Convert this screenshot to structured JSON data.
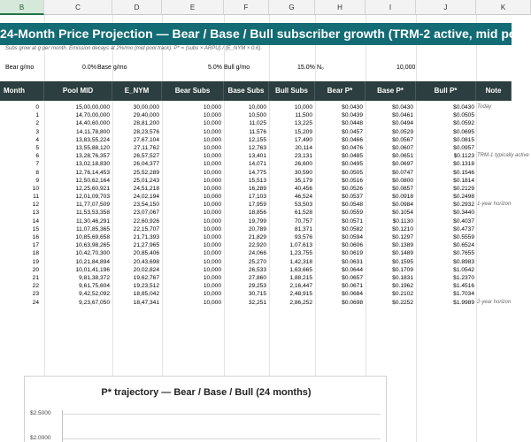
{
  "columns": [
    {
      "label": "B",
      "selected": true
    },
    {
      "label": "C"
    },
    {
      "label": "D"
    },
    {
      "label": "E"
    },
    {
      "label": "F"
    },
    {
      "label": "G"
    },
    {
      "label": "H"
    },
    {
      "label": "I"
    },
    {
      "label": "J"
    },
    {
      "label": "K"
    }
  ],
  "title": "24-Month Price Projection — Bear / Base / Bull subscriber growth (TRM-2 active, mid pool)",
  "subtitle": "Subs grow at g per month. Emission decays at 2%/mo (mid pool track). P* = (subs × ARPU) / (E_NYM × 0.6).",
  "params": {
    "bear_label": "Bear g/mo",
    "bear_value": "0.0%",
    "base_label": "Base g/mo",
    "base_value": "5.0%",
    "bull_label": "Bull g/mo",
    "bull_value": "15.0%",
    "n0_label": "N₀",
    "n0_value": "10,000"
  },
  "headers": [
    "Month",
    "Pool MID",
    "E_NYM",
    "Bear Subs",
    "Base Subs",
    "Bull Subs",
    "Bear P*",
    "Base P*",
    "Bull P*",
    "Note"
  ],
  "rows": [
    [
      "0",
      "15,00,00,000",
      "30,00,000",
      "10,000",
      "10,000",
      "10,000",
      "$0.0430",
      "$0.0430",
      "$0.0430",
      "Today"
    ],
    [
      "1",
      "14,70,00,000",
      "29,40,000",
      "10,000",
      "10,500",
      "11,500",
      "$0.0439",
      "$0.0461",
      "$0.0505",
      ""
    ],
    [
      "2",
      "14,40,60,000",
      "28,81,200",
      "10,000",
      "11,025",
      "13,225",
      "$0.0448",
      "$0.0494",
      "$0.0592",
      ""
    ],
    [
      "3",
      "14,11,78,800",
      "28,23,576",
      "10,000",
      "11,576",
      "15,209",
      "$0.0457",
      "$0.0529",
      "$0.0695",
      ""
    ],
    [
      "4",
      "13,83,55,224",
      "27,67,104",
      "10,000",
      "12,155",
      "17,490",
      "$0.0466",
      "$0.0567",
      "$0.0815",
      ""
    ],
    [
      "5",
      "13,55,88,120",
      "27,11,762",
      "10,000",
      "12,763",
      "20,114",
      "$0.0476",
      "$0.0607",
      "$0.0957",
      ""
    ],
    [
      "6",
      "13,28,76,357",
      "26,57,527",
      "10,000",
      "13,401",
      "23,131",
      "$0.0485",
      "$0.0651",
      "$0.1123",
      "TRM-1 typically active"
    ],
    [
      "7",
      "13,02,18,830",
      "26,04,377",
      "10,000",
      "14,071",
      "26,600",
      "$0.0495",
      "$0.0697",
      "$0.1318",
      ""
    ],
    [
      "8",
      "12,76,14,453",
      "25,52,289",
      "10,000",
      "14,775",
      "30,590",
      "$0.0505",
      "$0.0747",
      "$0.1546",
      ""
    ],
    [
      "9",
      "12,50,62,164",
      "25,01,243",
      "10,000",
      "15,513",
      "35,179",
      "$0.0516",
      "$0.0800",
      "$0.1814",
      ""
    ],
    [
      "10",
      "12,25,60,921",
      "24,51,218",
      "10,000",
      "16,289",
      "40,456",
      "$0.0526",
      "$0.0857",
      "$0.2129",
      ""
    ],
    [
      "11",
      "12,01,09,703",
      "24,02,194",
      "10,000",
      "17,103",
      "46,524",
      "$0.0537",
      "$0.0918",
      "$0.2498",
      ""
    ],
    [
      "12",
      "11,77,07,509",
      "23,54,150",
      "10,000",
      "17,959",
      "53,503",
      "$0.0548",
      "$0.0984",
      "$0.2932",
      "1-year horizon"
    ],
    [
      "13",
      "11,53,53,358",
      "23,07,067",
      "10,000",
      "18,856",
      "61,528",
      "$0.0559",
      "$0.1054",
      "$0.3440",
      ""
    ],
    [
      "14",
      "11,30,46,291",
      "22,60,926",
      "10,000",
      "19,799",
      "70,757",
      "$0.0571",
      "$0.1130",
      "$0.4037",
      ""
    ],
    [
      "15",
      "11,07,85,365",
      "22,15,707",
      "10,000",
      "20,789",
      "81,371",
      "$0.0582",
      "$0.1210",
      "$0.4737",
      ""
    ],
    [
      "16",
      "10,85,69,658",
      "21,71,393",
      "10,000",
      "21,829",
      "93,576",
      "$0.0594",
      "$0.1297",
      "$0.5559",
      ""
    ],
    [
      "17",
      "10,63,98,265",
      "21,27,965",
      "10,000",
      "22,920",
      "1,07,613",
      "$0.0606",
      "$0.1389",
      "$0.6524",
      ""
    ],
    [
      "18",
      "10,42,70,300",
      "20,85,406",
      "10,000",
      "24,066",
      "1,23,755",
      "$0.0619",
      "$0.1489",
      "$0.7655",
      ""
    ],
    [
      "19",
      "10,21,84,894",
      "20,43,698",
      "10,000",
      "25,270",
      "1,42,318",
      "$0.0631",
      "$0.1595",
      "$0.8983",
      ""
    ],
    [
      "20",
      "10,01,41,196",
      "20,02,824",
      "10,000",
      "26,533",
      "1,63,665",
      "$0.0644",
      "$0.1709",
      "$1.0542",
      ""
    ],
    [
      "21",
      "9,81,38,372",
      "19,62,767",
      "10,000",
      "27,860",
      "1,88,215",
      "$0.0657",
      "$0.1831",
      "$1.2370",
      ""
    ],
    [
      "22",
      "9,61,75,604",
      "19,23,512",
      "10,000",
      "29,253",
      "2,16,447",
      "$0.0671",
      "$0.1962",
      "$1.4516",
      ""
    ],
    [
      "23",
      "9,42,52,092",
      "18,85,042",
      "10,000",
      "30,715",
      "2,48,915",
      "$0.0684",
      "$0.2102",
      "$1.7034",
      ""
    ],
    [
      "24",
      "9,23,67,050",
      "18,47,341",
      "10,000",
      "32,251",
      "2,86,252",
      "$0.0698",
      "$0.2252",
      "$1.9989",
      "2-year horizon"
    ]
  ],
  "chart": {
    "title": "P* trajectory — Bear / Base / Bull (24 months)",
    "yticks": [
      "$2.5000",
      "$2.0000"
    ]
  }
}
